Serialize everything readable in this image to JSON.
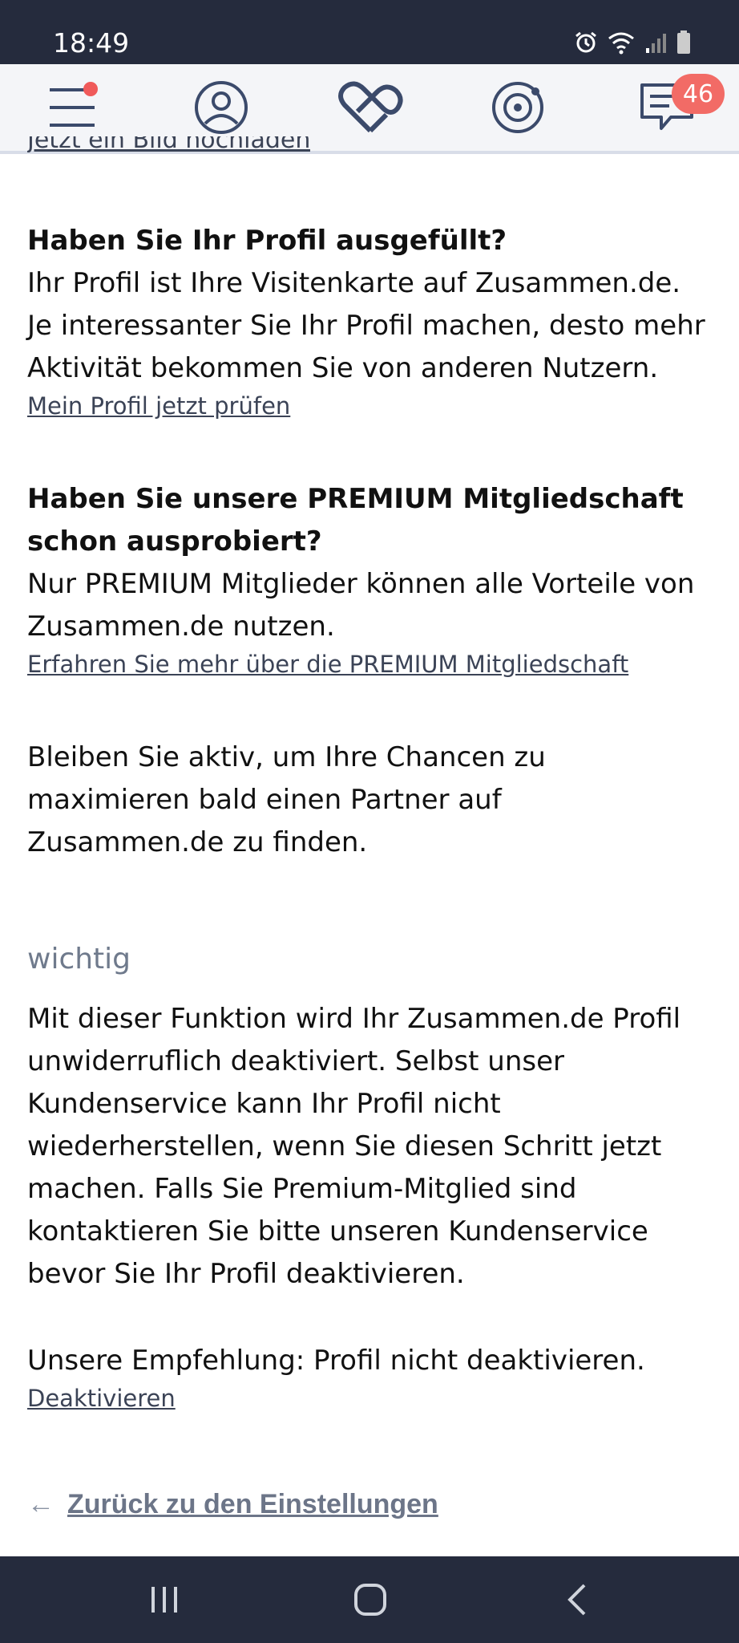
{
  "status_bar": {
    "time": "18:49"
  },
  "nav": {
    "messages_badge": "46"
  },
  "content": {
    "cut_link": "Jetzt ein Bild hochladen",
    "section_profile": {
      "title": "Haben Sie Ihr Profil ausgefüllt?",
      "line1": "Ihr Profil ist Ihre Visitenkarte auf Zusammen.de.",
      "line2": "Je interessanter Sie Ihr Profil machen, desto mehr",
      "line3": "Aktivität bekommen Sie von anderen Nutzern.",
      "link": "Mein Profil jetzt prüfen"
    },
    "section_premium": {
      "title_line1": "Haben Sie unsere PREMIUM Mitgliedschaft",
      "title_line2": "schon ausprobiert?",
      "line1": "Nur PREMIUM Mitglieder können alle Vorteile von",
      "line2": "Zusammen.de nutzen.",
      "link": "Erfahren Sie mehr über die PREMIUM Mitgliedschaft"
    },
    "stay_active": {
      "line1": "Bleiben Sie aktiv, um Ihre Chancen zu",
      "line2": "maximieren bald einen Partner auf",
      "line3": "Zusammen.de zu finden."
    },
    "important": {
      "label": "wichtig",
      "line1": "Mit dieser Funktion wird Ihr Zusammen.de Profil",
      "line2": "unwiderruflich deaktiviert. Selbst unser",
      "line3": "Kundenservice kann Ihr Profil nicht",
      "line4": "wiederherstellen, wenn Sie diesen Schritt jetzt",
      "line5": "machen. Falls Sie Premium-Mitglied sind",
      "line6": "kontaktieren Sie bitte unseren Kundenservice",
      "line7": "bevor Sie Ihr Profil deaktivieren."
    },
    "recommendation": "Unsere Empfehlung: Profil nicht deaktivieren.",
    "deactivate_link": "Deaktivieren",
    "back_arrow": "←",
    "back_link": "Zurück zu den Einstellungen"
  },
  "colors": {
    "status_bar_bg": "#252b3d",
    "nav_bg": "#f4f5f8",
    "icon_color": "#3b4a6b",
    "badge_color": "#f26b66",
    "link_color": "#3b4356",
    "muted_color": "#6f7a8c"
  },
  "icons": {
    "menu": "hamburger-menu-icon",
    "profile": "user-profile-icon",
    "match": "heart-infinity-icon",
    "radar": "radar-icon",
    "messages": "chat-bubble-icon"
  }
}
